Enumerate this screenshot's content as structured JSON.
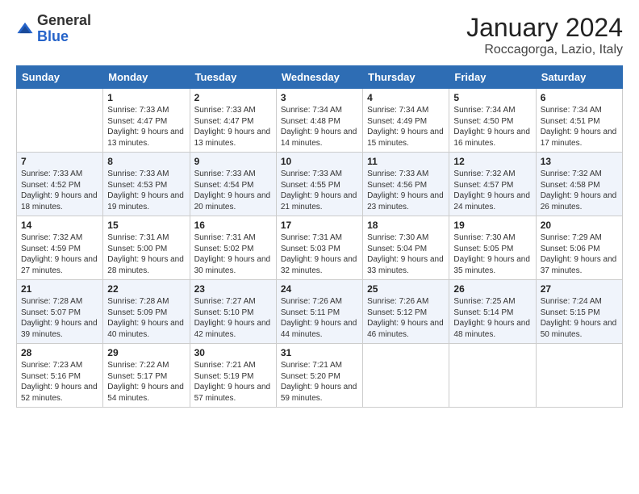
{
  "logo": {
    "general": "General",
    "blue": "Blue"
  },
  "header": {
    "title": "January 2024",
    "subtitle": "Roccagorga, Lazio, Italy"
  },
  "weekdays": [
    "Sunday",
    "Monday",
    "Tuesday",
    "Wednesday",
    "Thursday",
    "Friday",
    "Saturday"
  ],
  "weeks": [
    [
      {
        "day": "",
        "sunrise": "",
        "sunset": "",
        "daylight": ""
      },
      {
        "day": "1",
        "sunrise": "Sunrise: 7:33 AM",
        "sunset": "Sunset: 4:47 PM",
        "daylight": "Daylight: 9 hours and 13 minutes."
      },
      {
        "day": "2",
        "sunrise": "Sunrise: 7:33 AM",
        "sunset": "Sunset: 4:47 PM",
        "daylight": "Daylight: 9 hours and 13 minutes."
      },
      {
        "day": "3",
        "sunrise": "Sunrise: 7:34 AM",
        "sunset": "Sunset: 4:48 PM",
        "daylight": "Daylight: 9 hours and 14 minutes."
      },
      {
        "day": "4",
        "sunrise": "Sunrise: 7:34 AM",
        "sunset": "Sunset: 4:49 PM",
        "daylight": "Daylight: 9 hours and 15 minutes."
      },
      {
        "day": "5",
        "sunrise": "Sunrise: 7:34 AM",
        "sunset": "Sunset: 4:50 PM",
        "daylight": "Daylight: 9 hours and 16 minutes."
      },
      {
        "day": "6",
        "sunrise": "Sunrise: 7:34 AM",
        "sunset": "Sunset: 4:51 PM",
        "daylight": "Daylight: 9 hours and 17 minutes."
      }
    ],
    [
      {
        "day": "7",
        "sunrise": "Sunrise: 7:33 AM",
        "sunset": "Sunset: 4:52 PM",
        "daylight": "Daylight: 9 hours and 18 minutes."
      },
      {
        "day": "8",
        "sunrise": "Sunrise: 7:33 AM",
        "sunset": "Sunset: 4:53 PM",
        "daylight": "Daylight: 9 hours and 19 minutes."
      },
      {
        "day": "9",
        "sunrise": "Sunrise: 7:33 AM",
        "sunset": "Sunset: 4:54 PM",
        "daylight": "Daylight: 9 hours and 20 minutes."
      },
      {
        "day": "10",
        "sunrise": "Sunrise: 7:33 AM",
        "sunset": "Sunset: 4:55 PM",
        "daylight": "Daylight: 9 hours and 21 minutes."
      },
      {
        "day": "11",
        "sunrise": "Sunrise: 7:33 AM",
        "sunset": "Sunset: 4:56 PM",
        "daylight": "Daylight: 9 hours and 23 minutes."
      },
      {
        "day": "12",
        "sunrise": "Sunrise: 7:32 AM",
        "sunset": "Sunset: 4:57 PM",
        "daylight": "Daylight: 9 hours and 24 minutes."
      },
      {
        "day": "13",
        "sunrise": "Sunrise: 7:32 AM",
        "sunset": "Sunset: 4:58 PM",
        "daylight": "Daylight: 9 hours and 26 minutes."
      }
    ],
    [
      {
        "day": "14",
        "sunrise": "Sunrise: 7:32 AM",
        "sunset": "Sunset: 4:59 PM",
        "daylight": "Daylight: 9 hours and 27 minutes."
      },
      {
        "day": "15",
        "sunrise": "Sunrise: 7:31 AM",
        "sunset": "Sunset: 5:00 PM",
        "daylight": "Daylight: 9 hours and 28 minutes."
      },
      {
        "day": "16",
        "sunrise": "Sunrise: 7:31 AM",
        "sunset": "Sunset: 5:02 PM",
        "daylight": "Daylight: 9 hours and 30 minutes."
      },
      {
        "day": "17",
        "sunrise": "Sunrise: 7:31 AM",
        "sunset": "Sunset: 5:03 PM",
        "daylight": "Daylight: 9 hours and 32 minutes."
      },
      {
        "day": "18",
        "sunrise": "Sunrise: 7:30 AM",
        "sunset": "Sunset: 5:04 PM",
        "daylight": "Daylight: 9 hours and 33 minutes."
      },
      {
        "day": "19",
        "sunrise": "Sunrise: 7:30 AM",
        "sunset": "Sunset: 5:05 PM",
        "daylight": "Daylight: 9 hours and 35 minutes."
      },
      {
        "day": "20",
        "sunrise": "Sunrise: 7:29 AM",
        "sunset": "Sunset: 5:06 PM",
        "daylight": "Daylight: 9 hours and 37 minutes."
      }
    ],
    [
      {
        "day": "21",
        "sunrise": "Sunrise: 7:28 AM",
        "sunset": "Sunset: 5:07 PM",
        "daylight": "Daylight: 9 hours and 39 minutes."
      },
      {
        "day": "22",
        "sunrise": "Sunrise: 7:28 AM",
        "sunset": "Sunset: 5:09 PM",
        "daylight": "Daylight: 9 hours and 40 minutes."
      },
      {
        "day": "23",
        "sunrise": "Sunrise: 7:27 AM",
        "sunset": "Sunset: 5:10 PM",
        "daylight": "Daylight: 9 hours and 42 minutes."
      },
      {
        "day": "24",
        "sunrise": "Sunrise: 7:26 AM",
        "sunset": "Sunset: 5:11 PM",
        "daylight": "Daylight: 9 hours and 44 minutes."
      },
      {
        "day": "25",
        "sunrise": "Sunrise: 7:26 AM",
        "sunset": "Sunset: 5:12 PM",
        "daylight": "Daylight: 9 hours and 46 minutes."
      },
      {
        "day": "26",
        "sunrise": "Sunrise: 7:25 AM",
        "sunset": "Sunset: 5:14 PM",
        "daylight": "Daylight: 9 hours and 48 minutes."
      },
      {
        "day": "27",
        "sunrise": "Sunrise: 7:24 AM",
        "sunset": "Sunset: 5:15 PM",
        "daylight": "Daylight: 9 hours and 50 minutes."
      }
    ],
    [
      {
        "day": "28",
        "sunrise": "Sunrise: 7:23 AM",
        "sunset": "Sunset: 5:16 PM",
        "daylight": "Daylight: 9 hours and 52 minutes."
      },
      {
        "day": "29",
        "sunrise": "Sunrise: 7:22 AM",
        "sunset": "Sunset: 5:17 PM",
        "daylight": "Daylight: 9 hours and 54 minutes."
      },
      {
        "day": "30",
        "sunrise": "Sunrise: 7:21 AM",
        "sunset": "Sunset: 5:19 PM",
        "daylight": "Daylight: 9 hours and 57 minutes."
      },
      {
        "day": "31",
        "sunrise": "Sunrise: 7:21 AM",
        "sunset": "Sunset: 5:20 PM",
        "daylight": "Daylight: 9 hours and 59 minutes."
      },
      {
        "day": "",
        "sunrise": "",
        "sunset": "",
        "daylight": ""
      },
      {
        "day": "",
        "sunrise": "",
        "sunset": "",
        "daylight": ""
      },
      {
        "day": "",
        "sunrise": "",
        "sunset": "",
        "daylight": ""
      }
    ]
  ]
}
